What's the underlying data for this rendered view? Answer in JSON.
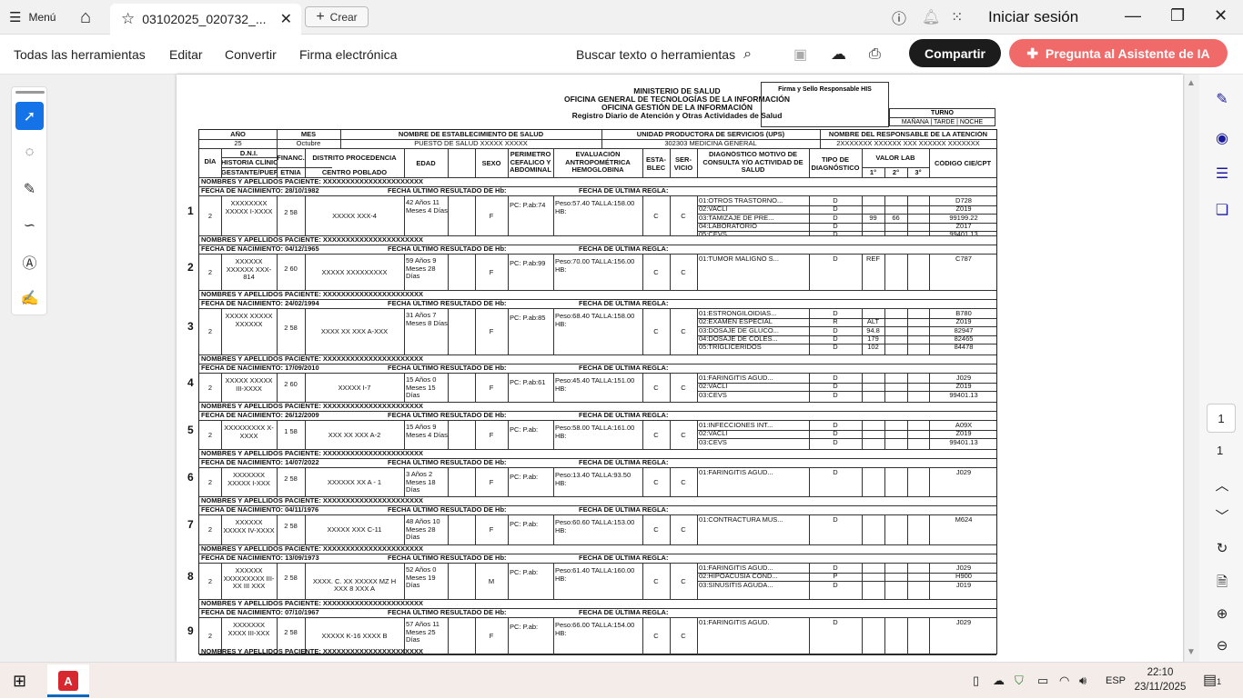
{
  "titlebar": {
    "menu_label": "Menú",
    "tab_title": "03102025_020732_...",
    "create_label": "Crear",
    "signin_label": "Iniciar sesión"
  },
  "toolbar": {
    "items": [
      "Todas las herramientas",
      "Editar",
      "Convertir",
      "Firma electrónica"
    ],
    "search_label": "Buscar texto o herramientas",
    "share_label": "Compartir",
    "ai_label": "Pregunta al Asistente de IA"
  },
  "page_nav": {
    "current": "1",
    "total": "1"
  },
  "document": {
    "header": {
      "lines": [
        "MINISTERIO DE SALUD",
        "OFICINA GENERAL DE TECNOLOGÍAS DE LA INFORMACIÓN",
        "OFICINA GESTIÓN DE LA INFORMACIÓN",
        "Registro Diario de Atención y Otras Actividades de Salud"
      ],
      "sign_label": "Firma y Sello Responsable HIS",
      "turno_title": "TURNO",
      "turno_options": "MAÑANA | TARDE | NOCHE"
    },
    "meta": {
      "year_label": "AÑO",
      "year_value": "25",
      "month_label": "MES",
      "month_value": "Octubre",
      "estab_label": "NOMBRE DE ESTABLECIMIENTO DE SALUD",
      "estab_value": "PUESTO DE SALUD XXXXX XXXXX",
      "ups_label": "UNIDAD PRODUCTORA DE SERVICIOS (UPS)",
      "ups_value": "302303 MEDICINA GENERAL",
      "resp_label": "NOMBRE DEL RESPONSABLE DE LA ATENCIÓN",
      "resp_value": "2XXXXXXX XXXXXX XXX XXXXXX XXXXXXX"
    },
    "columns": {
      "dia": "DÍA",
      "dni": "D.N.I.",
      "historia": "HISTORIA CLÍNICA",
      "gestante": "GESTANTE/PUERPERA",
      "financ": "FINANC.",
      "etnia": "ETNIA",
      "distrito": "DISTRITO PROCEDENCIA",
      "centro": "CENTRO POBLADO",
      "edad": "EDAD",
      "sexo": "SEXO",
      "perimetro": "PERIMETRO CEFALICO Y ABDOMINAL",
      "evaluacion": "EVALUACIÓN ANTROPOMÉTRICA HEMOGLOBINA",
      "estab": "ESTA- BLEC",
      "servicio": "SER- VICIO",
      "diagnostico": "DIAGNÓSTICO MOTIVO DE CONSULTA Y/O ACTIVIDAD DE SALUD",
      "tipo": "TIPO DE DIAGNÓSTICO",
      "valor": "VALOR LAB",
      "v1": "1°",
      "v2": "2°",
      "v3": "3°",
      "codigo": "CÓDIGO CIE/CPT"
    },
    "labels": {
      "nombres": "NOMBRES Y APELLIDOS PACIENTE: XXXXXXXXXXXXXXXXXXXXXX",
      "nacimiento": "FECHA DE NACIMIENTO:",
      "hb": "FECHA ÚLTIMO RESULTADO DE Hb:",
      "regla": "FECHA DE ÚLTIMA REGLA:"
    },
    "records": [
      {
        "num": "1",
        "nac": "28/10/1982",
        "dia": "2",
        "dni": "XXXXXXXX XXXXX I-XXXX",
        "fin": "2 58",
        "distrito": "XXXXX XXX-4",
        "edad": "42 Años 11 Meses 4 Días",
        "sexo": "F",
        "per": "PC: P.ab:74",
        "eval": "Peso:57.40 TALLA:158.00 HB:",
        "est": "C",
        "serv": "C",
        "dx": [
          "01:OTROS TRASTORNO...",
          "02:VACLI",
          "03:TAMIZAJE DE PRE...",
          "04:LABORATORIO",
          "05:CEVS"
        ],
        "tipo": [
          "D",
          "D",
          "D",
          "D",
          "D"
        ],
        "v1": [
          "",
          "",
          "99",
          "",
          ""
        ],
        "v2": [
          "",
          "",
          "66",
          "",
          ""
        ],
        "cod": [
          "D728",
          "Z019",
          "99199.22",
          "Z017",
          "99401.13"
        ]
      },
      {
        "num": "2",
        "nac": "04/12/1965",
        "dia": "2",
        "dni": "XXXXXX XXXXXX XXX-814",
        "fin": "2 60",
        "distrito": "XXXXX XXXXXXXXX",
        "edad": "59 Años 9 Meses 28 Días",
        "sexo": "F",
        "per": "PC: P.ab:99",
        "eval": "Peso:70.00 TALLA:156.00 HB:",
        "est": "C",
        "serv": "C",
        "dx": [
          "01:TUMOR MALIGNO S..."
        ],
        "tipo": [
          "D"
        ],
        "v1": [
          "REF"
        ],
        "v2": [
          ""
        ],
        "cod": [
          "C787"
        ]
      },
      {
        "num": "3",
        "nac": "24/02/1994",
        "dia": "2",
        "dni": "XXXXX XXXXX XXXXXX",
        "fin": "2 58",
        "distrito": "XXXX XX XXX A-XXX",
        "edad": "31 Años 7 Meses 8 Días",
        "sexo": "F",
        "per": "PC: P.ab:85",
        "eval": "Peso:68.40 TALLA:158.00 HB:",
        "est": "C",
        "serv": "C",
        "dx": [
          "01:ESTRONGILOIDIAS...",
          "02:EXAMEN ESPECIAL",
          "03:DOSAJE DE GLUCO...",
          "04:DOSAJE DE COLES...",
          "05:TRIGLICERIDOS"
        ],
        "tipo": [
          "D",
          "R",
          "D",
          "D",
          "D"
        ],
        "v1": [
          "",
          "ALT",
          "94.8",
          "179",
          "102"
        ],
        "v2": [
          "",
          "",
          "",
          "",
          ""
        ],
        "cod": [
          "B780",
          "Z019",
          "82947",
          "82465",
          "84478"
        ]
      },
      {
        "num": "4",
        "nac": "17/09/2010",
        "dia": "2",
        "dni": "XXXXX XXXXX III-XXXX",
        "fin": "2 60",
        "distrito": "XXXXX I-7",
        "edad": "15 Años 0 Meses 15 Días",
        "sexo": "F",
        "per": "PC: P.ab:61",
        "eval": "Peso:45.40 TALLA:151.00 HB:",
        "est": "C",
        "serv": "C",
        "dx": [
          "01:FARINGITIS AGUD...",
          "02:VACLI",
          "03:CEVS"
        ],
        "tipo": [
          "D",
          "D",
          "D"
        ],
        "v1": [
          "",
          "",
          ""
        ],
        "v2": [
          "",
          "",
          ""
        ],
        "cod": [
          "J029",
          "Z019",
          "99401.13"
        ]
      },
      {
        "num": "5",
        "nac": "26/12/2009",
        "dia": "2",
        "dni": "XXXXXXXXX X- XXXX",
        "fin": "1 58",
        "distrito": "XXX XX XXX A-2",
        "edad": "15 Años 9 Meses 4 Días",
        "sexo": "F",
        "per": "PC: P.ab:",
        "eval": "Peso:58.00 TALLA:161.00 HB:",
        "est": "C",
        "serv": "C",
        "dx": [
          "01:INFECCIONES INT...",
          "02:VACLI",
          "03:CEVS"
        ],
        "tipo": [
          "D",
          "D",
          "D"
        ],
        "v1": [
          "",
          "",
          ""
        ],
        "v2": [
          "",
          "",
          ""
        ],
        "cod": [
          "A09X",
          "Z019",
          "99401.13"
        ]
      },
      {
        "num": "6",
        "nac": "14/07/2022",
        "dia": "2",
        "dni": "XXXXXXX XXXXX I-XXX",
        "fin": "2 58",
        "distrito": "XXXXXX XX A - 1",
        "edad": "3 Años 2 Meses 18 Días",
        "sexo": "F",
        "per": "PC: P.ab:",
        "eval": "Peso:13.40 TALLA:93.50 HB:",
        "est": "C",
        "serv": "C",
        "dx": [
          "01:FARINGITIS AGUD..."
        ],
        "tipo": [
          "D"
        ],
        "v1": [
          ""
        ],
        "v2": [
          ""
        ],
        "cod": [
          "J029"
        ]
      },
      {
        "num": "7",
        "nac": "04/11/1976",
        "dia": "2",
        "dni": "XXXXXX XXXXX IV-XXXX",
        "fin": "2 58",
        "distrito": "XXXXX XXX C-11",
        "edad": "48 Años 10 Meses 28 Días",
        "sexo": "F",
        "per": "PC: P.ab:",
        "eval": "Peso:60.60 TALLA:153.00 HB:",
        "est": "C",
        "serv": "C",
        "dx": [
          "01:CONTRACTURA MUS..."
        ],
        "tipo": [
          "D"
        ],
        "v1": [
          ""
        ],
        "v2": [
          ""
        ],
        "cod": [
          "M624"
        ]
      },
      {
        "num": "8",
        "nac": "13/09/1973",
        "dia": "2",
        "dni": "XXXXXX XXXXXXXXX III- XX III XXX",
        "fin": "2 58",
        "distrito": "XXXX. C. XX XXXXX MZ H XXX 8 XXX A",
        "edad": "52 Años 0 Meses 19 Días",
        "sexo": "M",
        "per": "PC: P.ab:",
        "eval": "Peso:61.40 TALLA:160.00 HB:",
        "est": "C",
        "serv": "C",
        "dx": [
          "01:FARINGITIS AGUD...",
          "02:HIPOACUSIA COND...",
          "03:SINUSITIS AGUDA..."
        ],
        "tipo": [
          "D",
          "P",
          "D"
        ],
        "v1": [
          "",
          "",
          ""
        ],
        "v2": [
          "",
          "",
          ""
        ],
        "cod": [
          "J029",
          "H900",
          "J019"
        ]
      },
      {
        "num": "9",
        "nac": "07/10/1967",
        "dia": "2",
        "dni": "XXXXXXX XXXX III-XXX",
        "fin": "2 58",
        "distrito": "XXXXX K-16 XXXX B",
        "edad": "57 Años 11 Meses 25 Días",
        "sexo": "F",
        "per": "PC: P.ab:",
        "eval": "Peso:66.00 TALLA:154.00 HB:",
        "est": "C",
        "serv": "C",
        "dx": [
          "01:FARINGITIS AGUD."
        ],
        "tipo": [
          "D"
        ],
        "v1": [
          ""
        ],
        "v2": [
          ""
        ],
        "cod": [
          "J029"
        ]
      }
    ]
  },
  "taskbar": {
    "lang": "ESP",
    "time": "22:10",
    "date": "23/11/2025",
    "notif_count": "1"
  }
}
